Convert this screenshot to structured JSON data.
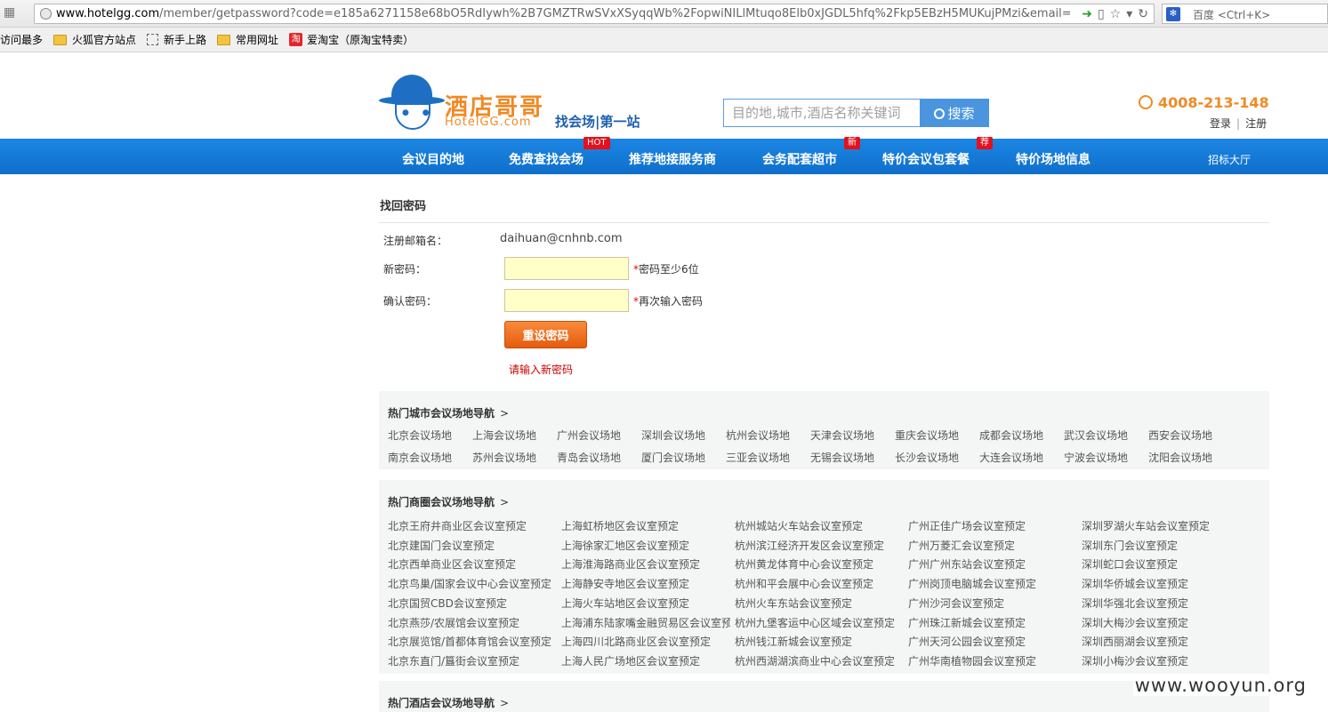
{
  "browser": {
    "url_host": "www.hotelgg.com",
    "url_path": "/member/getpassword?code=e185a6271158e68bO5RdIywh%2B7GMZTRwSVxXSyqqWb%2FopwiNILlMtuqo8Elb0xJGDL5hfq%2Fkp5EBzH5MUKujPMzi&email=daihuan@cnhnb.c",
    "search_engine_placeholder": "百度 <Ctrl+K>",
    "bookmarks": [
      {
        "label": "访问最多",
        "icon": "none"
      },
      {
        "label": "火狐官方站点",
        "icon": "folder-icon"
      },
      {
        "label": "新手上路",
        "icon": "dashed-page-icon"
      },
      {
        "label": "常用网址",
        "icon": "folder-icon"
      },
      {
        "label": "爱淘宝（原淘宝特卖）",
        "icon": "taobao-icon",
        "icon_text": "淘"
      }
    ]
  },
  "header": {
    "logo_cn": "酒店哥哥",
    "logo_en": "HotelGG.com",
    "slogan": "找会场|第一站",
    "search_placeholder": "目的地,城市,酒店名称关键词",
    "search_button": "搜索",
    "hotline": "4008-213-148",
    "login": "登录",
    "register": "注册"
  },
  "nav": {
    "items": [
      {
        "label": "会议目的地"
      },
      {
        "label": "免费查找会场",
        "badge": "HOT"
      },
      {
        "label": "推荐地接服务商"
      },
      {
        "label": "会务配套超市",
        "badge": "新"
      },
      {
        "label": "特价会议包套餐",
        "badge": "荐"
      },
      {
        "label": "特价场地信息"
      }
    ],
    "right_link": "招标大厅"
  },
  "form": {
    "title": "找回密码",
    "email_label": "注册邮箱名：",
    "email_value": "daihuan@cnhnb.com",
    "new_pw_label": "新密码：",
    "new_pw_hint": "密码至少6位",
    "confirm_pw_label": "确认密码：",
    "confirm_pw_hint": "再次输入密码",
    "required_mark": "*",
    "submit": "重设密码",
    "error": "请输入新密码"
  },
  "city_nav": {
    "title": "热门城市会议场地导航",
    "links": [
      "北京会议场地",
      "上海会议场地",
      "广州会议场地",
      "深圳会议场地",
      "杭州会议场地",
      "天津会议场地",
      "重庆会议场地",
      "成都会议场地",
      "武汉会议场地",
      "西安会议场地",
      "南京会议场地",
      "苏州会议场地",
      "青岛会议场地",
      "厦门会议场地",
      "三亚会议场地",
      "无锡会议场地",
      "长沙会议场地",
      "大连会议场地",
      "宁波会议场地",
      "沈阳会议场地"
    ]
  },
  "district_nav": {
    "title": "热门商圈会议场地导航",
    "columns": [
      [
        "北京王府井商业区会议室预定",
        "北京建国门会议室预定",
        "北京西单商业区会议室预定",
        "北京鸟巢/国家会议中心会议室预定",
        "北京国贸CBD会议室预定",
        "北京燕莎/农展馆会议室预定",
        "北京展览馆/首都体育馆会议室预定",
        "北京东直门/簋街会议室预定"
      ],
      [
        "上海虹桥地区会议室预定",
        "上海徐家汇地区会议室预定",
        "上海淮海路商业区会议室预定",
        "上海静安寺地区会议室预定",
        "上海火车站地区会议室预定",
        "上海浦东陆家嘴金融贸易区会议室预定",
        "上海四川北路商业区会议室预定",
        "上海人民广场地区会议室预定"
      ],
      [
        "杭州城站火车站会议室预定",
        "杭州滨江经济开发区会议室预定",
        "杭州黄龙体育中心会议室预定",
        "杭州和平会展中心会议室预定",
        "杭州火车东站会议室预定",
        "杭州九堡客运中心区域会议室预定",
        "杭州钱江新城会议室预定",
        "杭州西湖湖滨商业中心会议室预定"
      ],
      [
        "广州正佳广场会议室预定",
        "广州万菱汇会议室预定",
        "广州广州东站会议室预定",
        "广州岗顶电脑城会议室预定",
        "广州沙河会议室预定",
        "广州珠江新城会议室预定",
        "广州天河公园会议室预定",
        "广州华南植物园会议室预定"
      ],
      [
        "深圳罗湖火车站会议室预定",
        "深圳东门会议室预定",
        "深圳蛇口会议室预定",
        "深圳华侨城会议室预定",
        "深圳华强北会议室预定",
        "深圳大梅沙会议室预定",
        "深圳西丽湖会议室预定",
        "深圳小梅沙会议室预定"
      ]
    ]
  },
  "hotel_nav": {
    "title": "热门酒店会议场地导航"
  },
  "watermark": "www.wooyun.org"
}
